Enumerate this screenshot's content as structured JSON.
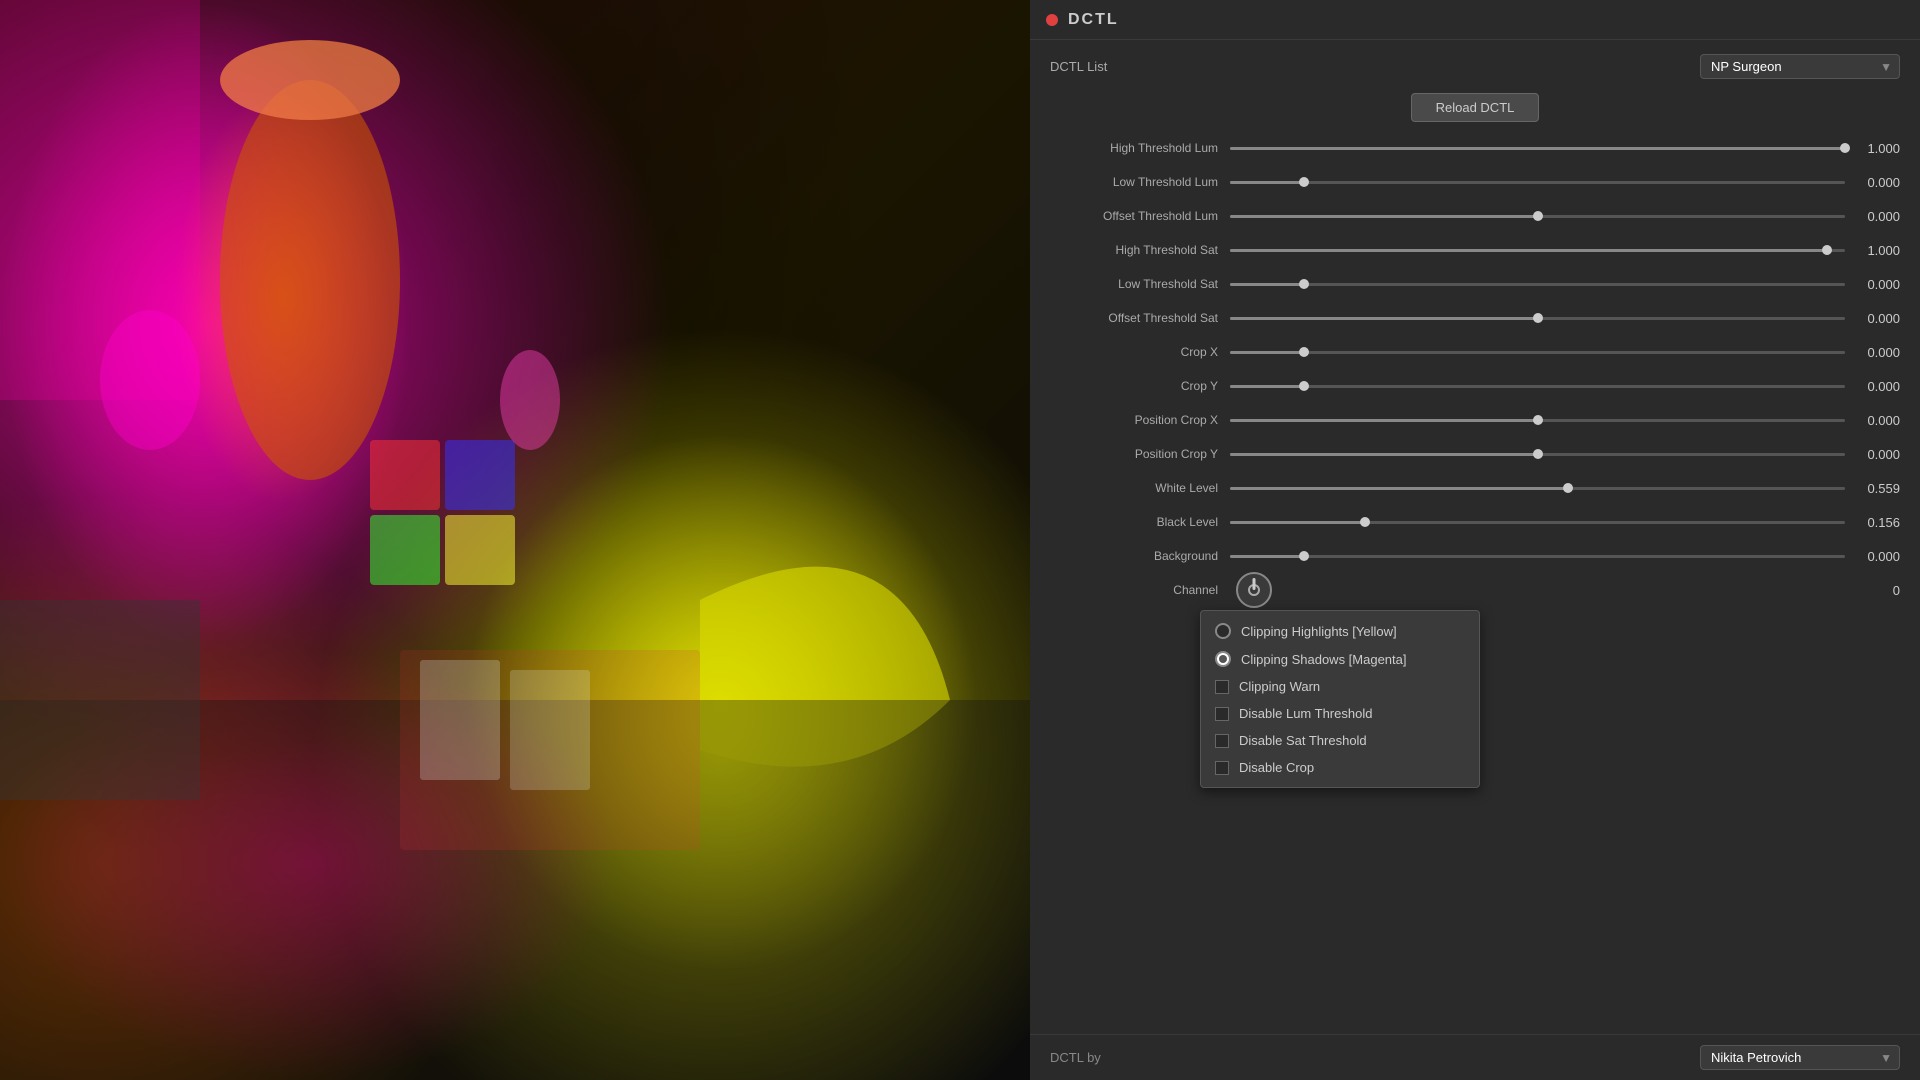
{
  "header": {
    "dot_color": "#e04040",
    "title": "DCTL"
  },
  "dctl_list": {
    "label": "DCTL List",
    "selected": "NP Surgeon",
    "options": [
      "NP Surgeon"
    ]
  },
  "reload_button": {
    "label": "Reload DCTL"
  },
  "sliders": [
    {
      "label": "High Threshold Lum",
      "value": "1.000",
      "percent": 100
    },
    {
      "label": "Low Threshold Lum",
      "value": "0.000",
      "percent": 12
    },
    {
      "label": "Offset Threshold Lum",
      "value": "0.000",
      "percent": 50
    },
    {
      "label": "High Threshold Sat",
      "value": "1.000",
      "percent": 97
    },
    {
      "label": "Low Threshold Sat",
      "value": "0.000",
      "percent": 12
    },
    {
      "label": "Offset Threshold Sat",
      "value": "0.000",
      "percent": 50
    },
    {
      "label": "Crop X",
      "value": "0.000",
      "percent": 12
    },
    {
      "label": "Crop Y",
      "value": "0.000",
      "percent": 12
    },
    {
      "label": "Position Crop X",
      "value": "0.000",
      "percent": 50
    },
    {
      "label": "Position Crop Y",
      "value": "0.000",
      "percent": 50
    },
    {
      "label": "White Level",
      "value": "0.559",
      "percent": 55
    },
    {
      "label": "Black Level",
      "value": "0.156",
      "percent": 22
    },
    {
      "label": "Background",
      "value": "0.000",
      "percent": 12
    }
  ],
  "channel": {
    "label": "Channel",
    "value": "0"
  },
  "dropdown_items": [
    {
      "label": "Clipping Highlights [Yellow]",
      "checked": false,
      "check_type": "circle"
    },
    {
      "label": "Clipping Shadows [Magenta]",
      "checked": true,
      "check_type": "circle"
    },
    {
      "label": "Clipping Warn",
      "checked": false,
      "check_type": "box"
    },
    {
      "label": "Disable Lum Threshold",
      "checked": false,
      "check_type": "box"
    },
    {
      "label": "Disable Sat Threshold",
      "checked": false,
      "check_type": "box"
    },
    {
      "label": "Disable Crop",
      "checked": false,
      "check_type": "box"
    }
  ],
  "dctl_by": {
    "label": "DCTL by",
    "author": "Nikita Petrovich"
  }
}
